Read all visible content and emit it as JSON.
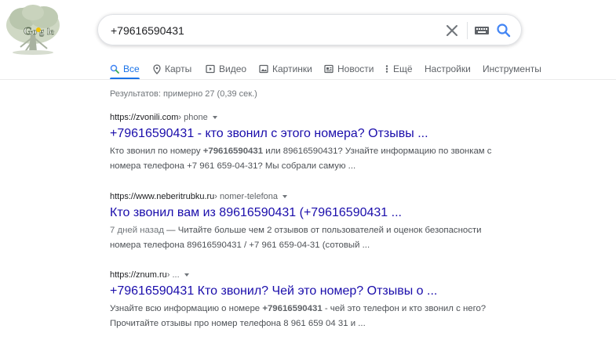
{
  "search": {
    "query": "+79616590431"
  },
  "tabs": [
    {
      "label": "Все"
    },
    {
      "label": "Карты"
    },
    {
      "label": "Видео"
    },
    {
      "label": "Картинки"
    },
    {
      "label": "Новости"
    },
    {
      "label": "Ещё"
    },
    {
      "label": "Настройки"
    },
    {
      "label": "Инструменты"
    }
  ],
  "stats": "Результатов: примерно 27 (0,39 сек.)",
  "results": [
    {
      "site": "https://zvonili.com",
      "crumb": " › phone",
      "title": "+79616590431 - кто звонил с этого номера? Отзывы ...",
      "s1_pre": "Кто звонил по номеру ",
      "s1_bold": "+79616590431",
      "s1_post": " или 89616590431? Узнайте информацию по звонкам с",
      "s2": "номера телефона +7 961 659-04-31? Мы собрали самую ..."
    },
    {
      "site": "https://www.neberitrubku.ru",
      "crumb": " › nomer-telefona",
      "title": "Кто звонил вам из 89616590431 (+79616590431 ...",
      "date": "7 дней назад",
      "s1_post": " — Читайте больше чем 2 отзывов от пользователей и оценок безопасности",
      "s2": "номера телефона 89616590431 / +7 961 659-04-31 (сотовый ..."
    },
    {
      "site": "https://znum.ru",
      "crumb": " › ...",
      "title": "+79616590431 Кто звонил? Чей это номер? Отзывы о ...",
      "s1_pre": "Узнайте всю информацию о номере ",
      "s1_bold": "+79616590431",
      "s1_post": " - чей это телефон и кто звонил с него?",
      "s2": "Прочитайте отзывы про номер телефона 8 961 659 04 31 и ..."
    }
  ],
  "colors": {
    "accent": "#1a73e8",
    "link": "#1a0dab",
    "snippet": "#4d5156"
  },
  "icons": [
    "tree-doodle-logo",
    "clear-icon",
    "keyboard-icon",
    "search-icon",
    "search-tab-icon",
    "map-pin-icon",
    "video-icon",
    "image-icon",
    "news-icon",
    "more-dots-icon"
  ]
}
